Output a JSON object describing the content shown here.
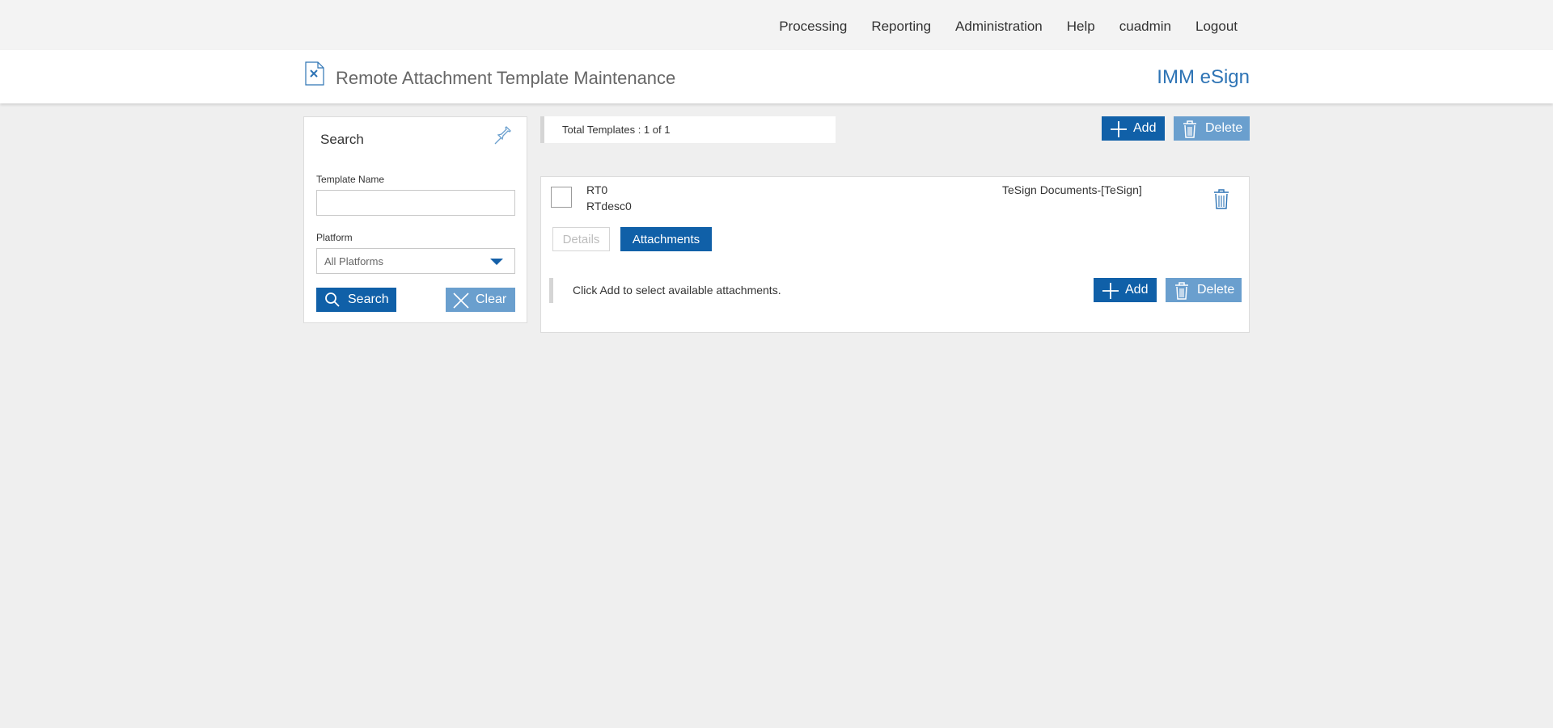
{
  "nav": {
    "items": [
      "Processing",
      "Reporting",
      "Administration",
      "Help",
      "cuadmin",
      "Logout"
    ]
  },
  "header": {
    "icon": "document-x-icon",
    "title": "Remote Attachment Template Maintenance",
    "brand": "IMM eSign"
  },
  "search": {
    "title": "Search",
    "pin_icon": "pin-icon",
    "template_name_label": "Template Name",
    "template_name_value": "",
    "platform_label": "Platform",
    "platform_value": "All Platforms",
    "search_button": "Search",
    "clear_button": "Clear"
  },
  "toolbar": {
    "total_text": "Total Templates : 1 of 1",
    "add_button": "Add",
    "delete_button": "Delete"
  },
  "templates": [
    {
      "name": "RT0",
      "description": "RTdesc0",
      "platform": "TeSign Documents-[TeSign]",
      "checked": false,
      "tabs": {
        "details": "Details",
        "attachments": "Attachments",
        "active": "attachments"
      },
      "attachments_message": "Click Add to select available attachments.",
      "add_button": "Add",
      "delete_button": "Delete"
    }
  ],
  "colors": {
    "primary": "#1060a8",
    "primary_light": "#6a9fce",
    "brand": "#2e74b5",
    "background": "#efefef"
  }
}
